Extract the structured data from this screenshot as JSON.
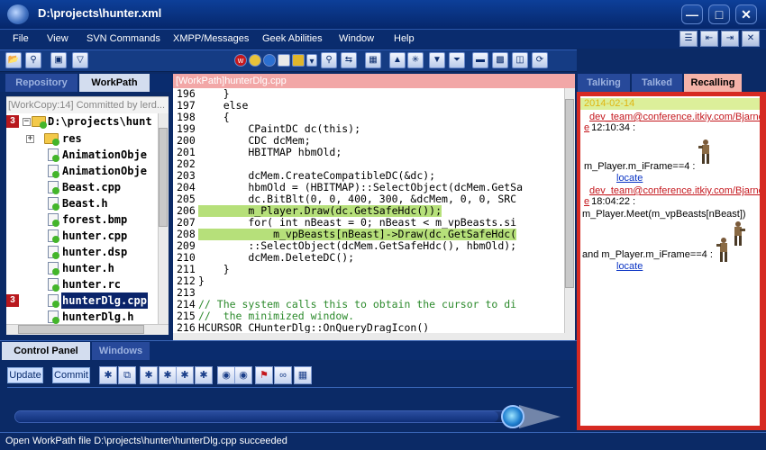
{
  "window": {
    "title": "D:\\projects\\hunter.xml"
  },
  "menu": {
    "items": [
      "File",
      "View",
      "SVN Commands",
      "XMPP/Messages",
      "Geek Abilities",
      "Window",
      "Help"
    ]
  },
  "left_tabs": {
    "repository": "Repository",
    "workpath": "WorkPath"
  },
  "left_info": "[WorkCopy:14] Committed by lerd...",
  "tree": {
    "root": "D:\\projects\\hunt",
    "items": [
      {
        "label": "res",
        "kind": "folder",
        "badge": ""
      },
      {
        "label": "AnimationObje",
        "kind": "file",
        "badge": ""
      },
      {
        "label": "AnimationObje",
        "kind": "file",
        "badge": ""
      },
      {
        "label": "Beast.cpp",
        "kind": "file",
        "badge": ""
      },
      {
        "label": "Beast.h",
        "kind": "file",
        "badge": ""
      },
      {
        "label": "forest.bmp",
        "kind": "file",
        "badge": ""
      },
      {
        "label": "hunter.cpp",
        "kind": "file",
        "badge": ""
      },
      {
        "label": "hunter.dsp",
        "kind": "file",
        "badge": ""
      },
      {
        "label": "hunter.h",
        "kind": "file",
        "badge": ""
      },
      {
        "label": "hunter.rc",
        "kind": "file",
        "badge": ""
      },
      {
        "label": "hunterDlg.cpp",
        "kind": "file",
        "badge": "3",
        "selected": true
      },
      {
        "label": "hunterDlg.h",
        "kind": "file",
        "badge": ""
      }
    ],
    "root_badge": "3"
  },
  "editor": {
    "tab_title": "[WorkPath]hunterDlg.cpp",
    "lines": [
      {
        "n": "196",
        "text": "    }"
      },
      {
        "n": "197",
        "text": "    else"
      },
      {
        "n": "198",
        "text": "    {"
      },
      {
        "n": "199",
        "text": "        CPaintDC dc(this);"
      },
      {
        "n": "200",
        "text": "        CDC dcMem;"
      },
      {
        "n": "201",
        "text": "        HBITMAP hbmOld;"
      },
      {
        "n": "202",
        "text": ""
      },
      {
        "n": "203",
        "text": "        dcMem.CreateCompatibleDC(&dc);"
      },
      {
        "n": "204",
        "text": "        hbmOld = (HBITMAP)::SelectObject(dcMem.GetSa"
      },
      {
        "n": "205",
        "text": "        dc.BitBlt(0, 0, 400, 300, &dcMem, 0, 0, SRC"
      },
      {
        "n": "206",
        "text": "        m_Player.Draw(dc.GetSafeHdc());"
      },
      {
        "n": "207",
        "text": "        for( int nBeast = 0; nBeast < m_vpBeasts.si"
      },
      {
        "n": "208",
        "text": "            m_vpBeasts[nBeast]->Draw(dc.GetSafeHdc("
      },
      {
        "n": "209",
        "text": "        ::SelectObject(dcMem.GetSafeHdc(), hbmOld);"
      },
      {
        "n": "210",
        "text": "        dcMem.DeleteDC();"
      },
      {
        "n": "211",
        "text": "    }"
      },
      {
        "n": "212",
        "text": "}"
      },
      {
        "n": "213",
        "text": ""
      },
      {
        "n": "214",
        "text": "// The system calls this to obtain the cursor to di"
      },
      {
        "n": "215",
        "text": "//  the minimized window."
      },
      {
        "n": "216",
        "text": "HCURSOR CHunterDlg::OnQueryDragIcon()"
      }
    ]
  },
  "right_tabs": {
    "talking": "Talking",
    "talked": "Talked",
    "recalling": "Recalling"
  },
  "chat": {
    "date": "2014-02-14",
    "msg1_user": "dev_team@conference.itkiy.com/Bjarne",
    "msg1_time": "12:10:34 :",
    "msg1_text": "m_Player.m_iFrame==4 :",
    "locate_label": "locate",
    "msg2_user": "dev_team@conference.itkiy.com/Bjarne",
    "msg2_time": "18:04:22 :",
    "msg2_text": "m_Player.Meet(m_vpBeasts[nBeast])",
    "msg3_text": "and m_Player.m_iFrame==4 :"
  },
  "bottom_tabs": {
    "control_panel": "Control Panel",
    "windows": "Windows"
  },
  "control": {
    "update_label": "Update",
    "commit_label": "Commit",
    "progress_fraction": 0.96
  },
  "status": "Open WorkPath file D:\\projects\\hunter\\hunterDlg.cpp succeeded",
  "colors": {
    "accent": "#0b2a66",
    "selection": "#0a246a",
    "chat_border": "#d62a22",
    "link_red": "#c4171d"
  }
}
